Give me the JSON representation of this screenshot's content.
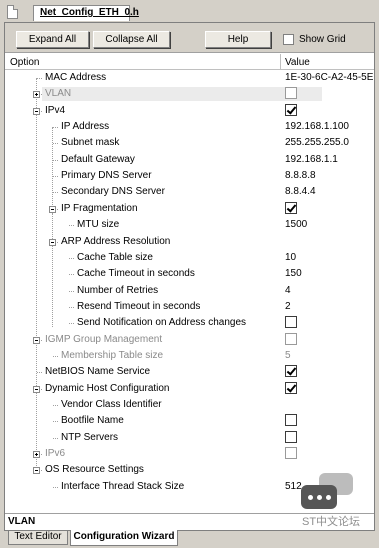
{
  "file_tab": {
    "title": "Net_Config_ETH_0.h"
  },
  "toolbar": {
    "expand_all": "Expand All",
    "collapse_all": "Collapse All",
    "help": "Help",
    "show_grid": "Show Grid",
    "show_grid_checked": false
  },
  "header": {
    "option": "Option",
    "value": "Value"
  },
  "rows": [
    {
      "label": "MAC Address",
      "value": "1E-30-6C-A2-45-5E"
    },
    {
      "label": "VLAN",
      "checked": false,
      "disabled": true
    },
    {
      "label": "IPv4",
      "checked": true
    },
    {
      "label": "IP Address",
      "value": "192.168.1.100"
    },
    {
      "label": "Subnet mask",
      "value": "255.255.255.0"
    },
    {
      "label": "Default Gateway",
      "value": "192.168.1.1"
    },
    {
      "label": "Primary DNS Server",
      "value": "8.8.8.8"
    },
    {
      "label": "Secondary DNS Server",
      "value": "8.8.4.4"
    },
    {
      "label": "IP Fragmentation",
      "checked": true
    },
    {
      "label": "MTU size",
      "value": "1500"
    },
    {
      "label": "ARP Address Resolution"
    },
    {
      "label": "Cache Table size",
      "value": "10"
    },
    {
      "label": "Cache Timeout in seconds",
      "value": "150"
    },
    {
      "label": "Number of Retries",
      "value": "4"
    },
    {
      "label": "Resend Timeout in seconds",
      "value": "2"
    },
    {
      "label": "Send Notification on Address changes",
      "checked": false
    },
    {
      "label": "IGMP Group Management",
      "checked": false,
      "disabled": true
    },
    {
      "label": "Membership Table size",
      "value": "5",
      "disabled": true
    },
    {
      "label": "NetBIOS Name Service",
      "checked": true
    },
    {
      "label": "Dynamic Host Configuration",
      "checked": true
    },
    {
      "label": "Vendor Class Identifier"
    },
    {
      "label": "Bootfile Name",
      "checked": false
    },
    {
      "label": "NTP Servers",
      "checked": false
    },
    {
      "label": "IPv6",
      "checked": false,
      "disabled": true
    },
    {
      "label": "OS Resource Settings"
    },
    {
      "label": "Interface Thread Stack Size",
      "value": "512"
    }
  ],
  "status": {
    "label": "VLAN"
  },
  "bottom_tabs": {
    "text_editor": "Text Editor",
    "configuration_wizard": "Configuration Wizard"
  },
  "watermark": {
    "text": "ST中文论坛"
  }
}
